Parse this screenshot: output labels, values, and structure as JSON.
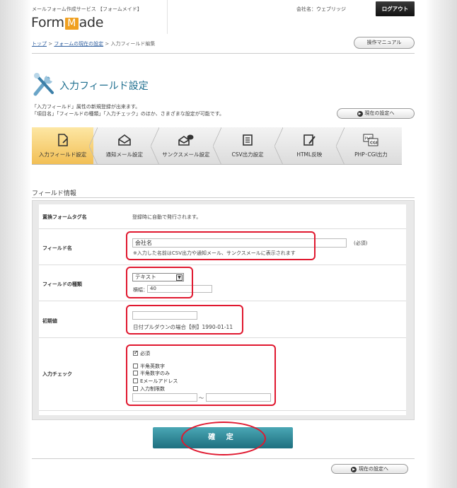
{
  "header": {
    "service_name": "メールフォーム作成サービス 【フォームメイド】",
    "logo_prefix": "Form",
    "logo_m": "M",
    "logo_suffix": "ade",
    "company": "会社名：ウェブリッジ",
    "logout_label": "ログアウト"
  },
  "breadcrumb": {
    "top": "トップ",
    "sep1": " > ",
    "current_form": "フォームの現在の設定",
    "sep2": " > ",
    "page": "入力フィールド編集"
  },
  "manual_label": "操作マニュアル",
  "page_title": "入力フィールド設定",
  "description": [
    "「入力フィールド」属性の新規登録が出来ます。",
    "「項目名」「フィールドの種類」「入力チェック」のほか、さまざまな設定が可能です。"
  ],
  "current_settings_label": "現在の設定へ",
  "tabs": [
    {
      "label": "入力フィールド設定",
      "icon": "field-edit-icon",
      "active": true
    },
    {
      "label": "通知メール設定",
      "icon": "envelope-icon",
      "active": false
    },
    {
      "label": "サンクスメール設定",
      "icon": "mail-chat-icon",
      "active": false
    },
    {
      "label": "CSV出力設定",
      "icon": "csv-list-icon",
      "active": false
    },
    {
      "label": "HTML反映",
      "icon": "html-edit-icon",
      "active": false
    },
    {
      "label": "PHP･CGI出力",
      "icon": "php-cgi-icon",
      "active": false
    }
  ],
  "section_title": "フィールド情報",
  "form": {
    "replace_tag": {
      "label": "置換フォームタグ名",
      "value": "登録時に自動で発行されます。"
    },
    "field_name": {
      "label": "フィールド名",
      "value": "会社名",
      "required_label": "(必須)",
      "note": "※入力した名前はCSV出力や通知メール、サンクスメールに表示されます"
    },
    "field_type": {
      "label": "フィールドの種類",
      "selected": "テキスト",
      "width_label": "横幅：",
      "width_value": "40"
    },
    "initial_value": {
      "label": "初期値",
      "value": "",
      "note": "日付プルダウンの場合【例】1990-01-11"
    },
    "input_check": {
      "label": "入力チェック",
      "required": {
        "label": "必須",
        "checked": true
      },
      "options": [
        {
          "label": "半角英数字",
          "checked": false
        },
        {
          "label": "半角数字のみ",
          "checked": false
        },
        {
          "label": "Eメールアドレス",
          "checked": false
        },
        {
          "label": "入力制限数",
          "checked": false
        }
      ],
      "range_separator": "～",
      "min_value": "",
      "max_value": ""
    }
  },
  "confirm_label": "確 定"
}
